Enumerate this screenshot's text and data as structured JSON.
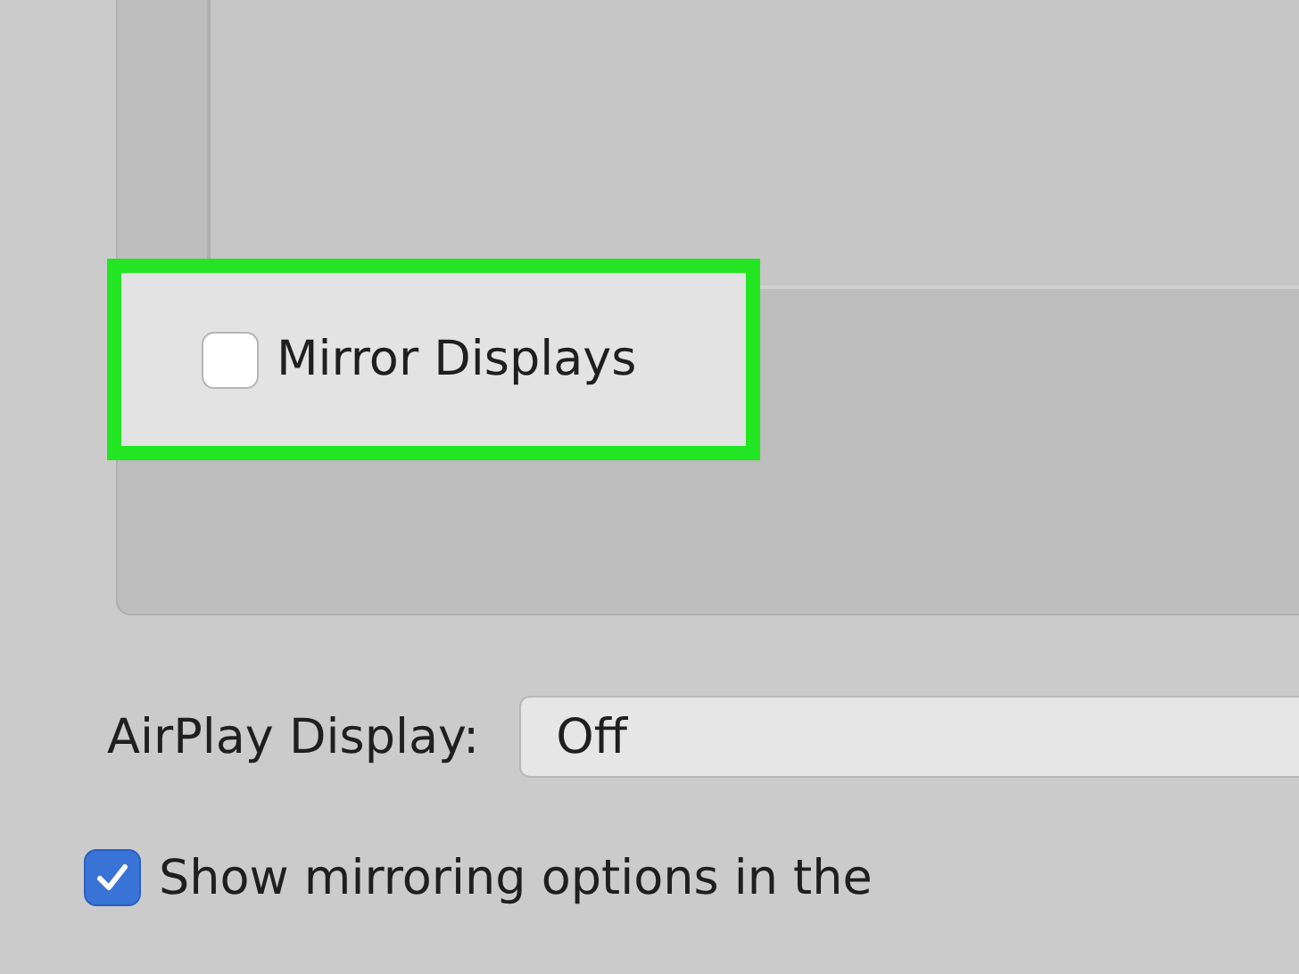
{
  "mirror_displays": {
    "label": "Mirror Displays",
    "checked": false
  },
  "airplay_display": {
    "label": "AirPlay Display:",
    "value": "Off"
  },
  "show_mirroring_options": {
    "label": "Show mirroring options in the",
    "checked": true
  }
}
